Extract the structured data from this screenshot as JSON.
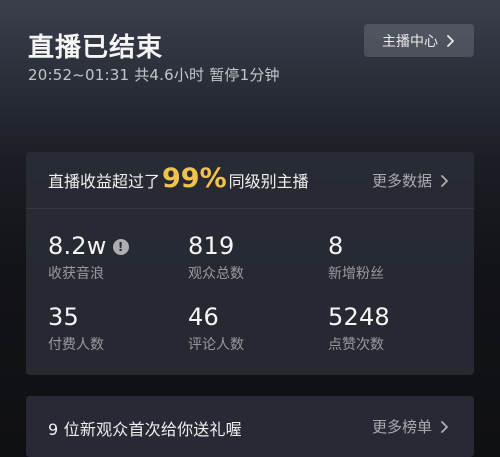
{
  "header": {
    "title": "直播已结束",
    "subtitle": "20:52~01:31 共4.6小时 暂停1分钟",
    "center_button_label": "主播中心"
  },
  "stats": {
    "headline_before": "直播收益超过了",
    "headline_percent": "99%",
    "headline_after": "同级别主播",
    "more_data_label": "更多数据",
    "metrics": [
      {
        "value": "8.2w",
        "label": "收获音浪",
        "info_glyph": "!"
      },
      {
        "value": "819",
        "label": "观众总数"
      },
      {
        "value": "8",
        "label": "新增粉丝"
      },
      {
        "value": "35",
        "label": "付费人数"
      },
      {
        "value": "46",
        "label": "评论人数"
      },
      {
        "value": "5248",
        "label": "点赞次数"
      }
    ]
  },
  "gift_section": {
    "text": "9 位新观众首次给你送礼喔",
    "more_label": "更多榜单"
  },
  "colors": {
    "accent_percent": "#f1c34d",
    "card_background": "#2a2d37",
    "muted_text": "#9a9ba1"
  },
  "icons": {
    "chevron": "chevron-right-icon",
    "info": "info-icon"
  }
}
